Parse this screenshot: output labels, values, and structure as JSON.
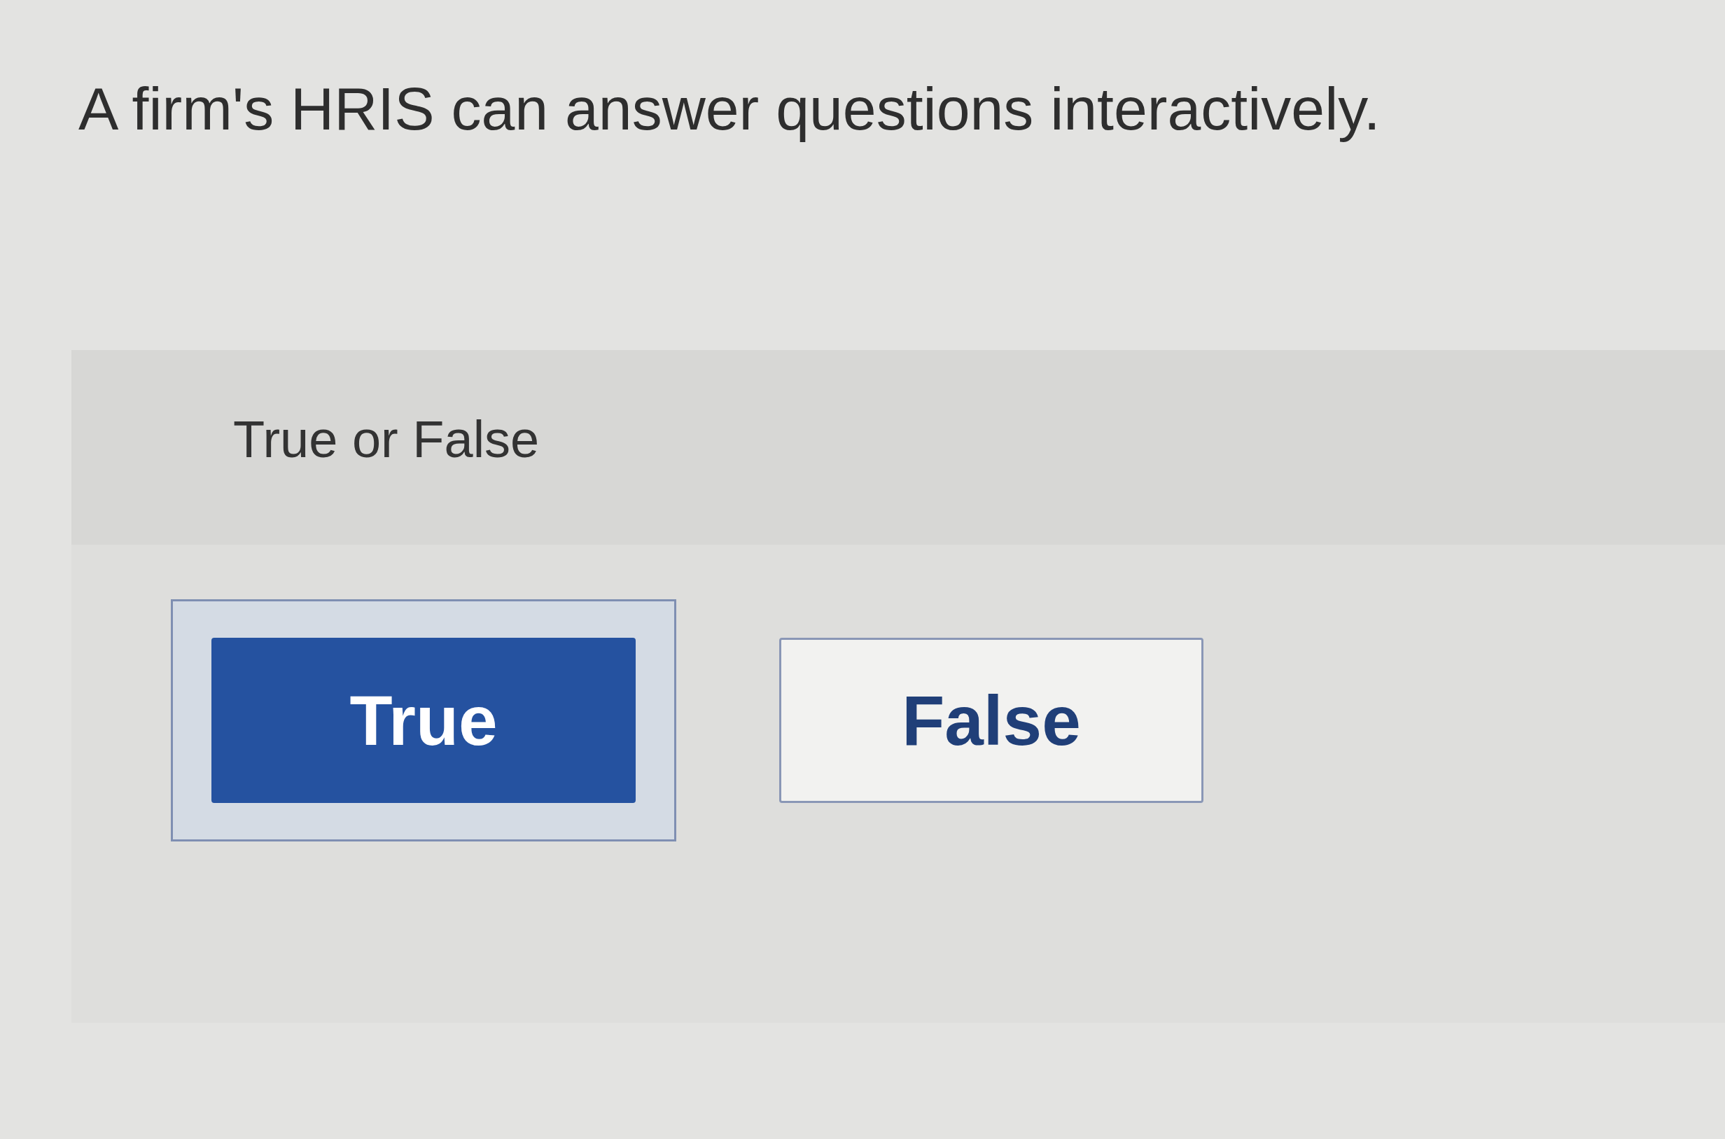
{
  "question": "A firm's HRIS can answer questions interactively.",
  "prompt": "True or False",
  "options": [
    {
      "label": "True",
      "selected": true
    },
    {
      "label": "False",
      "selected": false
    }
  ]
}
